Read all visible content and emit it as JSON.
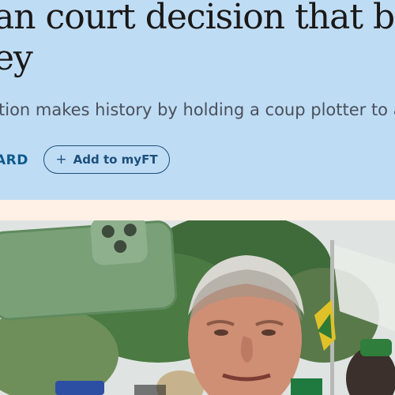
{
  "article": {
    "headline": "an court decision that bolste\ney",
    "standfirst": "tion makes history by holding a coup plotter to acco",
    "author_fragment": "ARD",
    "myft_button_label": "Add to myFT",
    "myft_icon": "plus-icon"
  },
  "image": {
    "description_icon": "photo"
  },
  "colors": {
    "header_background": "#bfdcf5",
    "page_background": "#fff1e5",
    "link": "#0d5a8c",
    "text": "#1a1817"
  }
}
